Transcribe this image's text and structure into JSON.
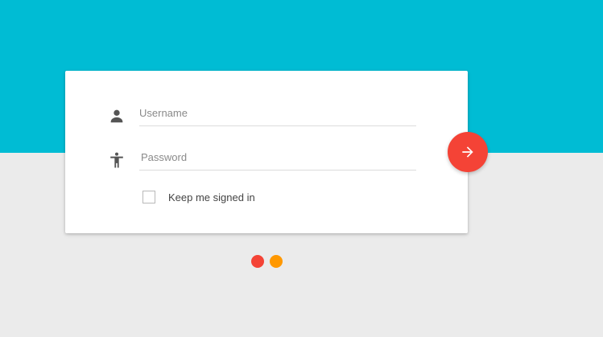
{
  "login": {
    "username_placeholder": "Username",
    "password_placeholder": "Password",
    "remember_label": "Keep me signed in",
    "remember_checked": false
  },
  "icons": {
    "username": "person-icon",
    "password": "accessibility-icon",
    "submit": "arrow-forward-icon"
  },
  "colors": {
    "header_band": "#00bcd4",
    "background": "#ebebeb",
    "card": "#ffffff",
    "fab": "#f44336",
    "dot_red": "#f44336",
    "dot_orange": "#ff9800"
  }
}
